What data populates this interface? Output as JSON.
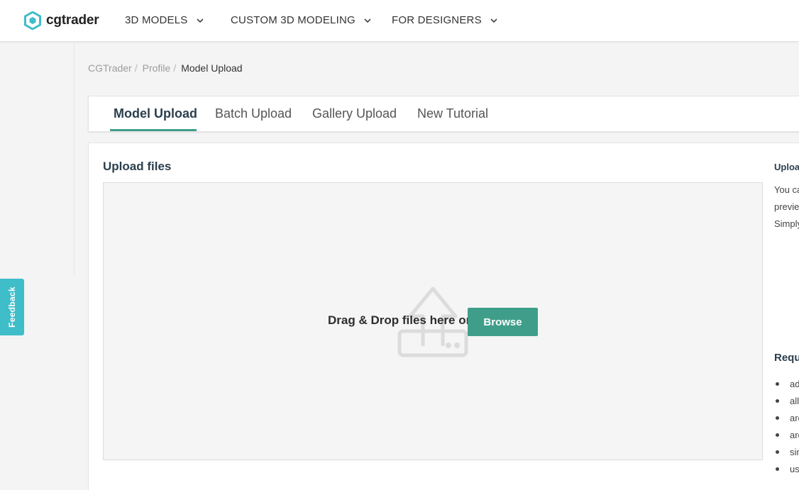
{
  "brand": {
    "name": "cgtrader",
    "logo_color": "#3fbdc9"
  },
  "nav": {
    "items": [
      {
        "label": "3D MODELS"
      },
      {
        "label": "CUSTOM 3D MODELING"
      },
      {
        "label": "FOR DESIGNERS"
      }
    ]
  },
  "breadcrumb": {
    "items": [
      "CGTrader",
      "Profile"
    ],
    "separator": "/",
    "current": "Model Upload"
  },
  "tabs": [
    {
      "label": "Model Upload",
      "active": true
    },
    {
      "label": "Batch Upload",
      "active": false
    },
    {
      "label": "Gallery Upload",
      "active": false
    },
    {
      "label": "New Tutorial",
      "active": false
    }
  ],
  "upload": {
    "title": "Upload files",
    "dropzone_text": "Drag & Drop files here or",
    "browse_label": "Browse"
  },
  "side": {
    "title": "Uploa",
    "lines": [
      "You ca",
      "previe",
      "Simply"
    ],
    "requirements_title": "Requ",
    "requirements": [
      "ad",
      "all",
      "arc",
      "arc",
      "sin",
      "use"
    ]
  },
  "feedback": {
    "label": "Feedback"
  },
  "colors": {
    "accent": "#3f9e8a",
    "feedback": "#3fbdc9",
    "heading": "#2b3f4d"
  }
}
